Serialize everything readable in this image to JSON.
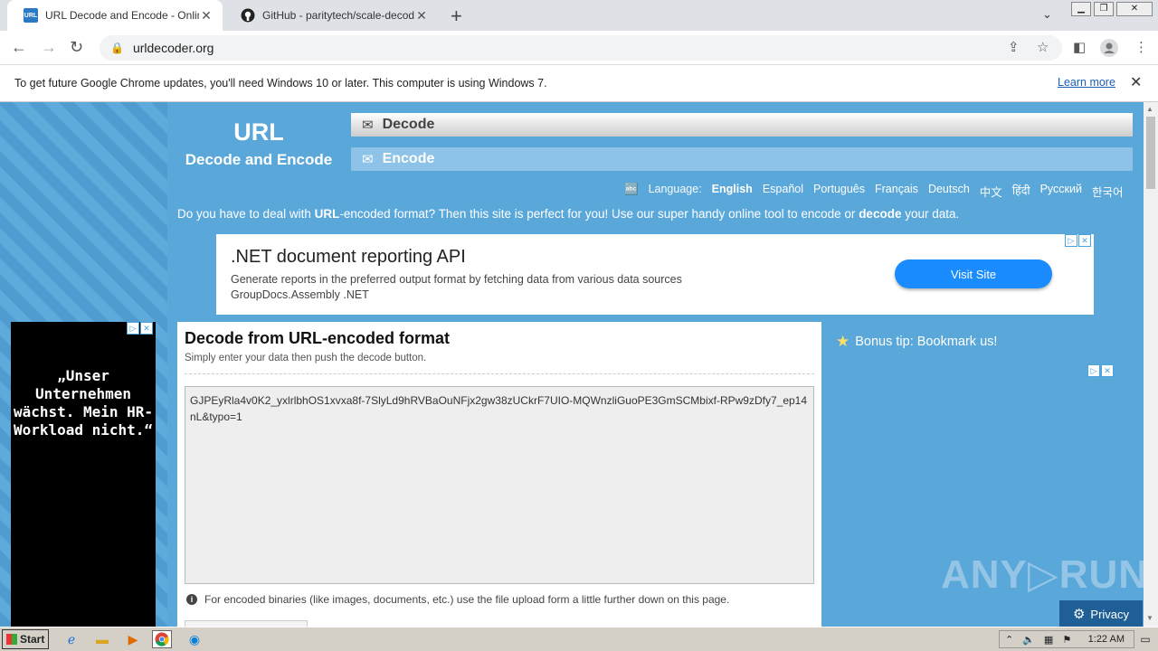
{
  "browser": {
    "tabs": [
      {
        "title": "URL Decode and Encode - Online",
        "favicon": "URL",
        "favicon_color": "#2b78c5",
        "close": "✕"
      },
      {
        "title": "GitHub - paritytech/scale-decode: De",
        "favicon": "github-icon",
        "close": "✕"
      }
    ],
    "new_tab": "+",
    "tab_dropdown": "⌄",
    "address": "urldecoder.org",
    "infobar": {
      "message": "To get future Google Chrome updates, you'll need Windows 10 or later. This computer is using Windows 7.",
      "learn_more": "Learn more",
      "close": "✕"
    }
  },
  "site": {
    "logo_line1": "URL",
    "logo_line2": "Decode and Encode",
    "nav": {
      "decode": "Decode",
      "encode": "Encode"
    },
    "language_label": "Language:",
    "languages": [
      "English",
      "Español",
      "Português",
      "Français",
      "Deutsch",
      "中文",
      "हिंदी",
      "Русский",
      "한국어"
    ],
    "tagline_parts": [
      "Do you have to deal with ",
      "URL",
      "-encoded format? Then this site is perfect for you! Use our super handy online tool to encode or ",
      "decode",
      " your data."
    ],
    "ad_top": {
      "headline": ".NET document reporting API",
      "line1": "Generate reports in the preferred output format by fetching data from various data sources",
      "line2": "GroupDocs.Assembly .NET",
      "button": "Visit Site"
    },
    "ad_left": {
      "text": "„Unser Unternehmen wächst. Mein HR-Workload nicht.“"
    },
    "main": {
      "title": "Decode from URL-encoded format",
      "subtitle": "Simply enter your data then push the decode button.",
      "input_value": "GJPEyRla4v0K2_yxlrlbhOS1xvxa8f-7SlyLd9hRVBaOuNFjx2gw38zUCkrF7UIO-MQWnzliGuoPE3GmSCMbixf-RPw9zDfy7_ep14nL&typo=1",
      "hint": "For encoded binaries (like images, documents, etc.) use the file upload form a little further down on this page."
    },
    "bonus_tip": "Bonus tip: Bookmark us!",
    "watermark": "ANY▷RUN",
    "privacy": "Privacy"
  },
  "taskbar": {
    "start": "Start",
    "clock": "1:22 AM"
  }
}
